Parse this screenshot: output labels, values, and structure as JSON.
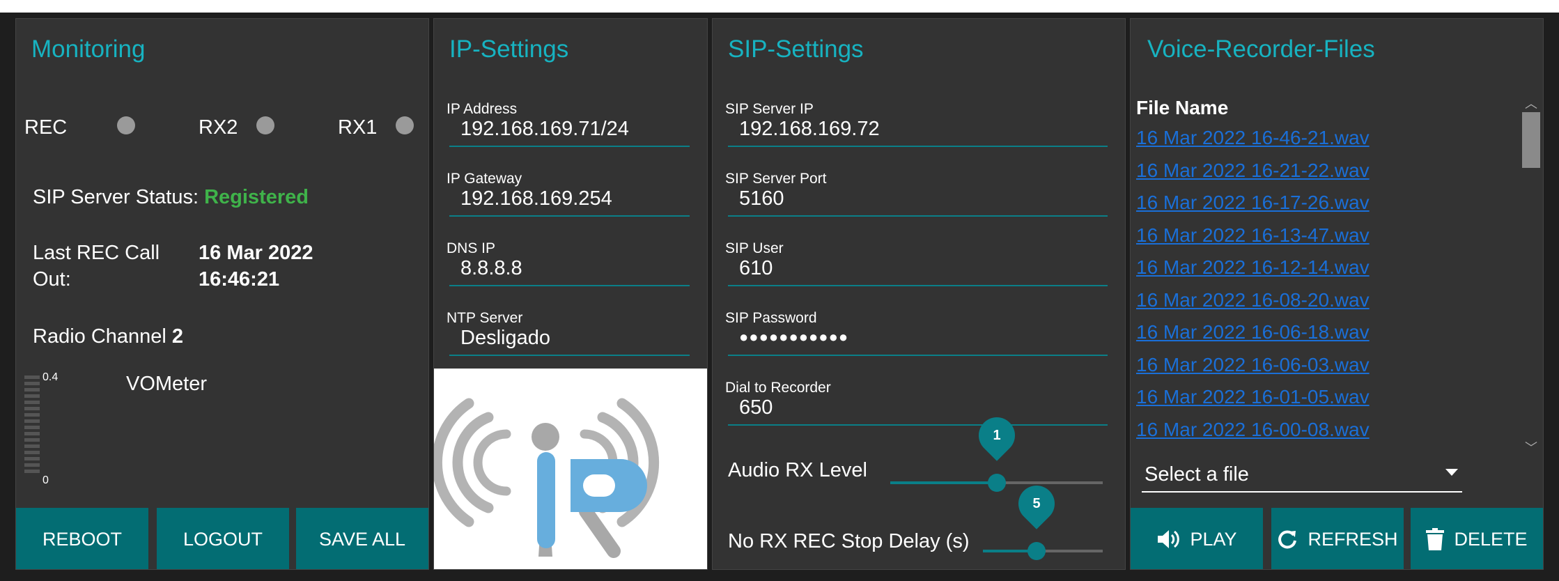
{
  "monitoring": {
    "title": "Monitoring",
    "leds": {
      "rec": "REC",
      "rx2": "RX2",
      "rx1": "RX1"
    },
    "sip_status_label": "SIP Server Status:",
    "sip_status_value": "Registered",
    "last_rec_label_1": "Last REC Call",
    "last_rec_label_2": "Out:",
    "last_rec_date": "16 Mar 2022",
    "last_rec_time": "16:46:21",
    "radio_channel_label": "Radio Channel",
    "radio_channel_value": "2",
    "vu_max": "0.4",
    "vu_min": "0",
    "vu_label": "VOMeter",
    "buttons": {
      "reboot": "REBOOT",
      "logout": "LOGOUT",
      "save_all": "SAVE ALL"
    }
  },
  "ip_settings": {
    "title": "IP-Settings",
    "fields": [
      {
        "label": "IP Address",
        "value": "192.168.169.71/24"
      },
      {
        "label": "IP Gateway",
        "value": "192.168.169.254"
      },
      {
        "label": "DNS IP",
        "value": "8.8.8.8"
      },
      {
        "label": "NTP Server",
        "value": "Desligado"
      }
    ]
  },
  "sip_settings": {
    "title": "SIP-Settings",
    "fields": [
      {
        "label": "SIP Server IP",
        "value": "192.168.169.72"
      },
      {
        "label": "SIP Server Port",
        "value": "5160"
      },
      {
        "label": "SIP User",
        "value": "610"
      },
      {
        "label": "SIP Password",
        "value": "●●●●●●●●●●●"
      },
      {
        "label": "Dial to Recorder",
        "value": "650"
      }
    ],
    "audio_rx_level": {
      "label": "Audio RX Level",
      "value": "1",
      "fraction": 0.5
    },
    "stop_delay": {
      "label": "No RX REC Stop Delay (s)",
      "value": "5",
      "fraction": 0.45
    }
  },
  "voice_recorder": {
    "title": "Voice-Recorder-Files",
    "column_header": "File Name",
    "files": [
      "16 Mar 2022 16-46-21.wav",
      "16 Mar 2022 16-21-22.wav",
      "16 Mar 2022 16-17-26.wav",
      "16 Mar 2022 16-13-47.wav",
      "16 Mar 2022 16-12-14.wav",
      "16 Mar 2022 16-08-20.wav",
      "16 Mar 2022 16-06-18.wav",
      "16 Mar 2022 16-06-03.wav",
      "16 Mar 2022 16-01-05.wav",
      "16 Mar 2022 16-00-08.wav"
    ],
    "select_placeholder": "Select a file",
    "buttons": {
      "play": "PLAY",
      "refresh": "REFRESH",
      "delete": "DELETE"
    }
  },
  "colors": {
    "accent": "#17b3c1",
    "button": "#036d73",
    "status_ok": "#3fb34a",
    "link": "#1a6fd8"
  }
}
